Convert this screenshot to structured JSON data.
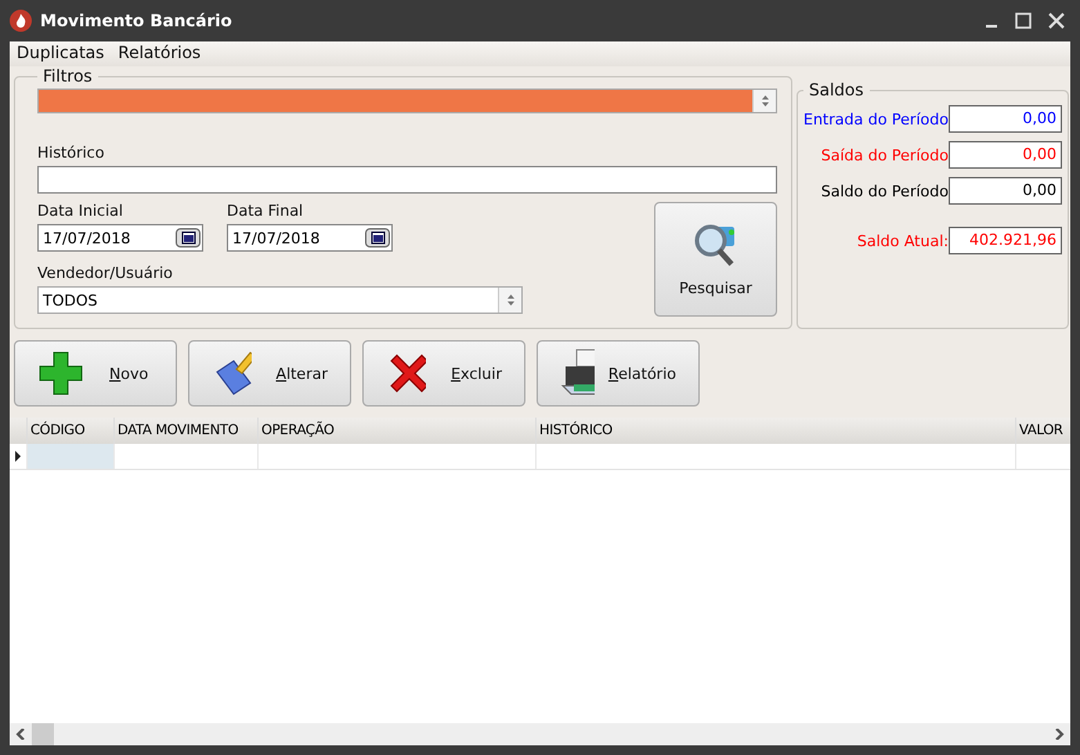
{
  "window": {
    "title": "Movimento Bancário"
  },
  "menu": [
    {
      "label": "Duplicatas"
    },
    {
      "label": "Relatórios"
    }
  ],
  "filters": {
    "title": "Filtros",
    "account_combo": {
      "focused": true
    },
    "history": {
      "label": "Histórico"
    },
    "start_date": {
      "label": "Data Inicial",
      "value": "17/07/2018"
    },
    "end_date": {
      "label": "Data Final",
      "value": "17/07/2018"
    },
    "user": {
      "label": "Vendedor/Usuário",
      "value": "TODOS"
    },
    "search_button": "Pesquisar"
  },
  "balances": {
    "title": "Saldos",
    "rows": [
      {
        "label": "Entrada do Período",
        "value": "0,00",
        "color": "#0000ff"
      },
      {
        "label": "Saída do Período",
        "value": "0,00",
        "color": "#ff0000"
      },
      {
        "label": "Saldo do Período",
        "value": "0,00",
        "color": "#000000"
      },
      {
        "label": "Saldo Atual:",
        "value": "402.921,96",
        "color": "#ff0000"
      }
    ]
  },
  "actions": [
    {
      "kind": "add",
      "label": "Novo"
    },
    {
      "kind": "edit",
      "label": "Alterar"
    },
    {
      "kind": "delete",
      "label": "Excluir"
    },
    {
      "kind": "print",
      "label": "Relatório"
    }
  ],
  "table": {
    "columns": [
      "CÓDIGO",
      "DATA MOVIMENTO",
      "OPERAÇÃO",
      "HISTÓRICO",
      "VALOR"
    ],
    "rows": [
      {
        "selected": true
      }
    ]
  }
}
